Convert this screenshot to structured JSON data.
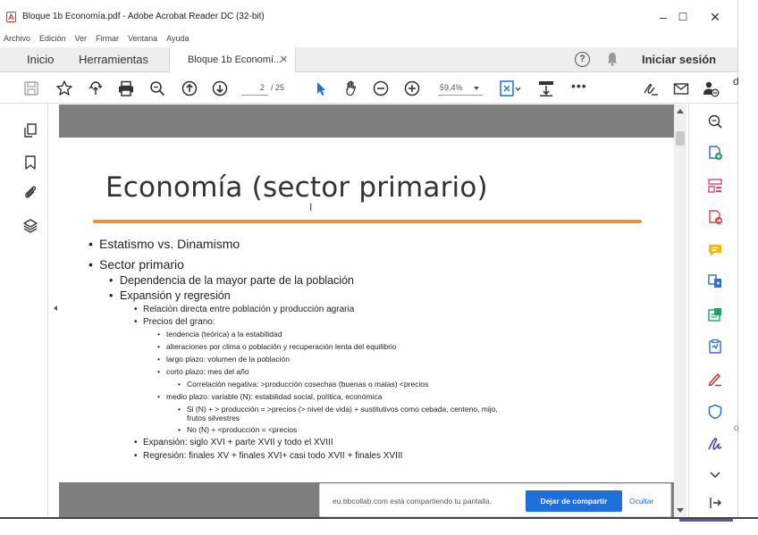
{
  "window": {
    "title": "Bloque 1b Economía.pdf - Adobe Acrobat Reader DC (32-bit)",
    "minimize": "–",
    "maximize": "☐",
    "close": "✕"
  },
  "menu": [
    "Archivo",
    "Edición",
    "Ver",
    "Firmar",
    "Ventana",
    "Ayuda"
  ],
  "tabs": {
    "home": "Inicio",
    "tools": "Herramientas",
    "document": "Bloque 1b Economí...",
    "close": "✕",
    "help": "?",
    "signin": "Iniciar sesión"
  },
  "toolbar": {
    "page_current": "2",
    "page_total": "/ 25",
    "zoom": "59,4%",
    "more": "•••"
  },
  "slide": {
    "title": "Economía (sector primario)",
    "bullets": [
      {
        "level": 1,
        "text": "Estatismo vs. Dinamismo"
      },
      {
        "level": 1,
        "text": "Sector primario"
      },
      {
        "level": 2,
        "text": "Dependencia de la mayor parte de la población"
      },
      {
        "level": 2,
        "text": "Expansión y regresión"
      },
      {
        "level": 3,
        "text": "Relación directa entre población y producción agraria"
      },
      {
        "level": 3,
        "text": "Precios del grano:"
      },
      {
        "level": 4,
        "text": "tendencia (teórica) a la estabilidad"
      },
      {
        "level": 4,
        "text": "alteraciones por clima o población y recuperación lenta del equilibrio"
      },
      {
        "level": 4,
        "text": "largo plazo: volumen de la población"
      },
      {
        "level": 4,
        "text": "corto plazo: mes del año"
      },
      {
        "level": 5,
        "text": "Correlación negativa: >producción cosechas (buenas o malas) <precios"
      },
      {
        "level": 4,
        "text": "medio plazo: variable (N): estabilidad social, política, económica"
      },
      {
        "level": 5,
        "text": "Si (N) + > producción = >precios (> nivel de vida) + sustitutivos como cebada, centeno, mijo,"
      },
      {
        "level": 6,
        "text": "frutos silvestres"
      },
      {
        "level": 5,
        "text": "No (N) + <producción = <precios"
      },
      {
        "level": 3,
        "text": "Expansión: siglo XVI + parte XVII y todo el XVIII"
      },
      {
        "level": 3,
        "text": "Regresión: finales XV + finales XVI+ casi todo XVII + finales XVIII"
      }
    ]
  },
  "share": {
    "text": "eu.bbcollab.com está compartiendo tu pantalla.",
    "stop": "Dejar de compartir",
    "hide": "Ocultar"
  },
  "edge": {
    "d": "d",
    "o": "o"
  },
  "colors": {
    "accent": "#1e6fd9",
    "title_rule": "#e8923c",
    "acrobat_red": "#d0312d"
  }
}
